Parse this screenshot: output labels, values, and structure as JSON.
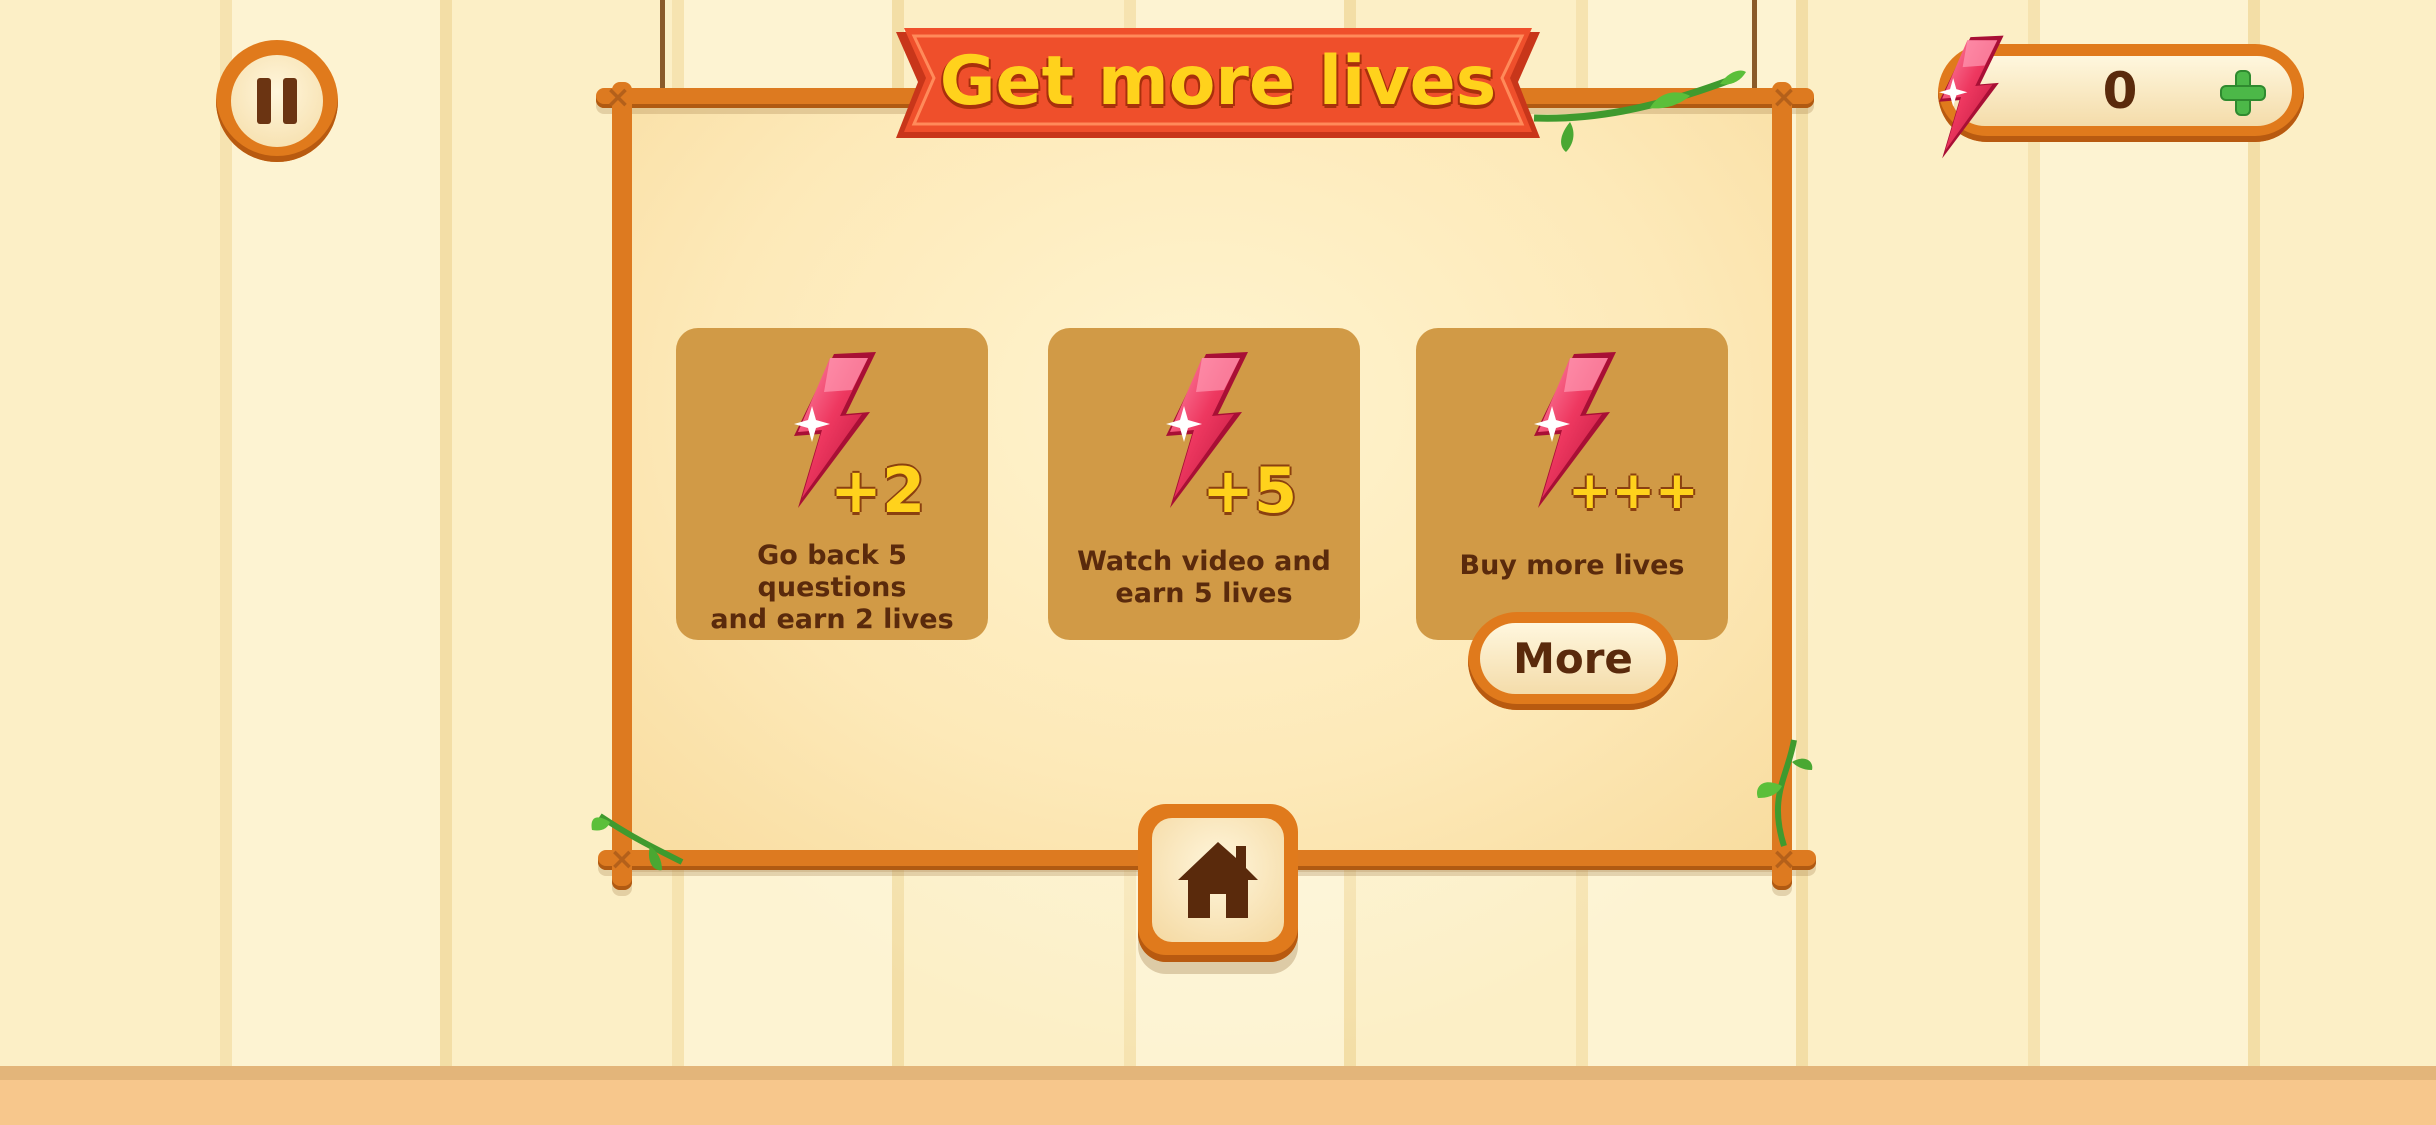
{
  "banner": {
    "title": "Get more lives"
  },
  "hud": {
    "pause_icon": "pause-icon",
    "lives_count": "0",
    "lives_icon": "lightning-bolt-icon",
    "add_icon": "plus-icon"
  },
  "cards": [
    {
      "bonus": "+2",
      "text_line1": "Go back 5 questions",
      "text_line2": "and earn 2 lives"
    },
    {
      "bonus": "+5",
      "text_line1": "Watch video and",
      "text_line2": "earn 5 lives"
    },
    {
      "bonus": "+++",
      "text_line1": "Buy more lives",
      "text_line2": ""
    }
  ],
  "more_button": {
    "label": "More"
  },
  "home_button": {
    "icon": "home-icon"
  },
  "colors": {
    "frame_orange": "#e07a1c",
    "card_tan": "#d19a46",
    "banner_red": "#ef4f2b",
    "title_yellow": "#ffd21c",
    "text_brown": "#5a2a0c",
    "plus_green": "#4cb848",
    "gem_pink": "#e8315a"
  }
}
